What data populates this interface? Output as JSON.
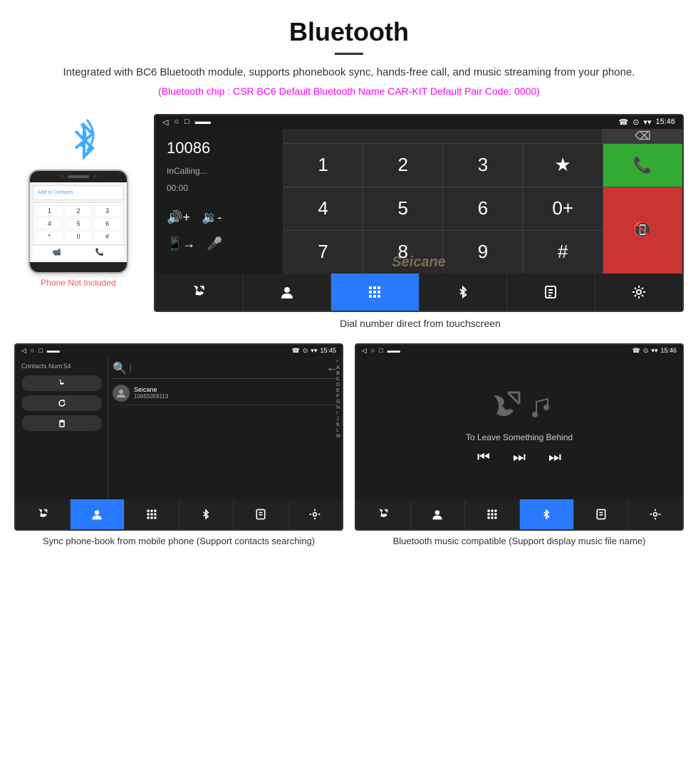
{
  "header": {
    "title": "Bluetooth",
    "description": "Integrated with BC6 Bluetooth module, supports phonebook sync, hands-free call, and music streaming from your phone.",
    "spec": "(Bluetooth chip : CSR BC6    Default Bluetooth Name CAR-KIT    Default Pair Code: 0000)"
  },
  "phone": {
    "not_included_label": "Phone Not Included",
    "add_contact_label": "Add to Contacts",
    "dialer_keys": [
      "1",
      "2",
      "3",
      "4",
      "5",
      "6",
      "*",
      "0",
      "#"
    ]
  },
  "car_screen": {
    "status_bar": {
      "time": "15:46",
      "left_icons": [
        "◁",
        "▭",
        "▢",
        "▬▬"
      ],
      "right_icons": [
        "☎",
        "⊙",
        "▾"
      ]
    },
    "number": "10086",
    "calling_status": "InCalling...",
    "timer": "00:00",
    "keypad": {
      "keys": [
        "1",
        "2",
        "3",
        "★",
        "4",
        "5",
        "6",
        "0+",
        "7",
        "8",
        "9",
        "#"
      ]
    },
    "bottom_nav": [
      {
        "icon": "📞↕",
        "label": "call-switch"
      },
      {
        "icon": "👤",
        "label": "contacts"
      },
      {
        "icon": "⠿",
        "label": "dialpad",
        "active": true
      },
      {
        "icon": "✱",
        "label": "bluetooth"
      },
      {
        "icon": "📋",
        "label": "files"
      },
      {
        "icon": "⚙",
        "label": "settings"
      }
    ]
  },
  "caption_main": "Dial number direct from touchscreen",
  "contacts_screen": {
    "status_bar_time": "15:45",
    "contacts_num_label": "Contacts Num:54",
    "contact_name": "Seicane",
    "contact_number": "10655059113",
    "index_letters": [
      "*",
      "A",
      "B",
      "C",
      "D",
      "E",
      "F",
      "G",
      "H",
      "I",
      "J",
      "K",
      "L",
      "M"
    ],
    "bottom_nav_active": "contacts"
  },
  "music_screen": {
    "status_bar_time": "15:46",
    "song_name": "To Leave Something Behind",
    "bottom_nav_active": "bluetooth"
  },
  "bottom_captions": {
    "contacts": "Sync phone-book from mobile phone\n(Support contacts searching)",
    "music": "Bluetooth music compatible\n(Support display music file name)"
  }
}
